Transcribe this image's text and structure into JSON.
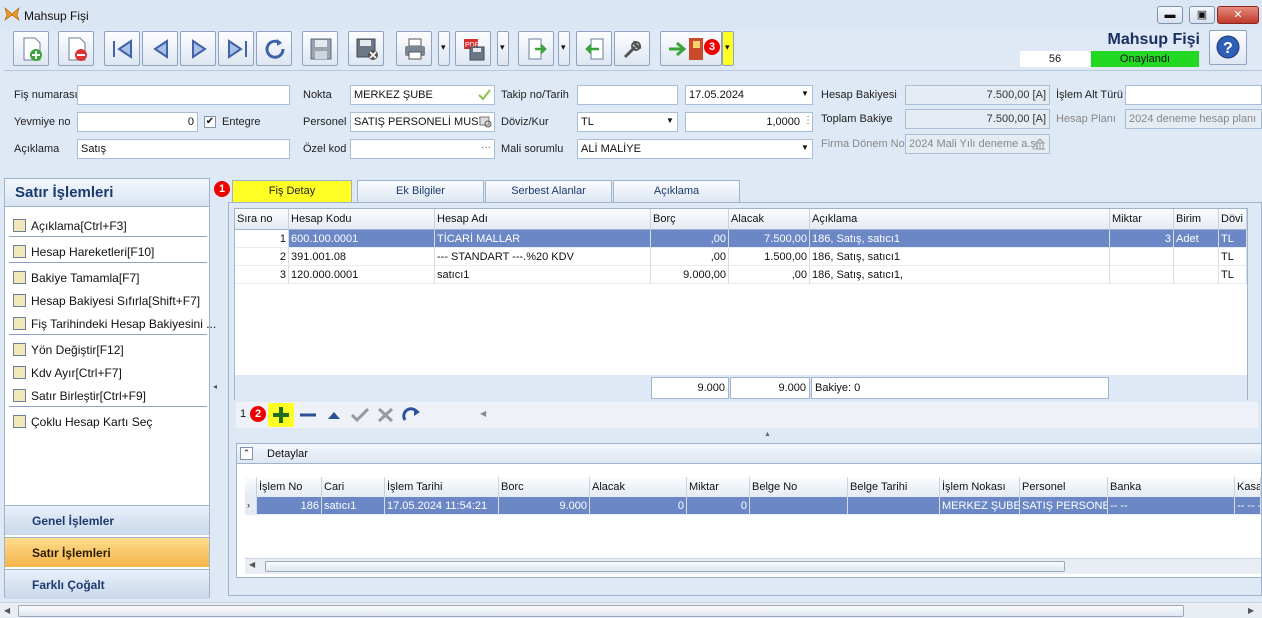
{
  "window": {
    "title": "Mahsup Fişi",
    "minimize": "▬",
    "maximize": "▣",
    "close": "✕"
  },
  "toolbar": {
    "buttons": [
      "new-icon",
      "delete-icon",
      "first-icon",
      "prev-icon",
      "next-icon",
      "last-icon",
      "refresh-icon",
      "save-icon",
      "save-cancel-icon",
      "print-icon",
      "pdf-save-icon",
      "export-icon",
      "import-icon",
      "tools-icon",
      "exit-door-icon"
    ],
    "badge_3": "3"
  },
  "header_right": {
    "title": "Mahsup Fişi",
    "number": "56",
    "status": "Onaylandı",
    "status_color": "#22d822"
  },
  "form": {
    "fis_no_label": "Fiş numarası",
    "fis_no_value": "",
    "yevmiye_label": "Yevmiye no",
    "yevmiye_value": "0",
    "entegre_label": "Entegre",
    "entegre_checked": true,
    "aciklama_label": "Açıklama",
    "aciklama_value": "Satış",
    "nokta_label": "Nokta",
    "nokta_value": "MERKEZ ŞUBE",
    "personel_label": "Personel",
    "personel_value": "SATIŞ PERSONELİ MUST",
    "ozel_kod_label": "Özel kod",
    "ozel_kod_value": "",
    "takip_label": "Takip no/Tarih",
    "takip_value": "",
    "tarih_value": "17.05.2024",
    "doviz_label": "Döviz/Kur",
    "doviz_value": "TL",
    "kur_value": "1,0000",
    "mali_label": "Mali sorumlu",
    "mali_value": "ALİ MALİYE",
    "hesap_bakiyesi_label": "Hesap Bakiyesi",
    "hesap_bakiyesi_value": "7.500,00 [A]",
    "toplam_bakiye_label": "Toplam Bakiye",
    "toplam_bakiye_value": "7.500,00 [A]",
    "firma_donem_label": "Firma Dönem No",
    "firma_donem_value": "2024 Mali Yılı deneme a.ş.",
    "islem_alt_label": "İşlem Alt Türü",
    "islem_alt_value": "",
    "hesap_plani_label": "Hesap Planı",
    "hesap_plani_value": "2024 deneme hesap planı"
  },
  "left_panel": {
    "title": "Satır İşlemleri",
    "items": [
      "Açıklama[Ctrl+F3]",
      "Hesap Hareketleri[F10]",
      "Bakiye Tamamla[F7]",
      "Hesap Bakiyesi Sıfırla[Shift+F7]",
      "Fiş Tarihindeki Hesap Bakiyesini ...",
      "Yön Değiştir[F12]",
      "Kdv Ayır[Ctrl+F7]",
      "Satır Birleştir[Ctrl+F9]",
      "Çoklu Hesap Kartı Seç"
    ],
    "groups": [
      "Genel İşlemler",
      "Satır İşlemleri",
      "Farklı Çoğalt"
    ]
  },
  "tabs": {
    "badge_1": "1",
    "items": [
      "Fiş Detay",
      "Ek Bilgiler",
      "Serbest Alanlar",
      "Açıklama"
    ]
  },
  "grid": {
    "columns": [
      "Sıra no",
      "Hesap Kodu",
      "Hesap Adı",
      "Borç",
      "Alacak",
      "Açıklama",
      "Miktar",
      "Birim",
      "Dövi"
    ],
    "rows": [
      [
        "1",
        "600.100.0001",
        "TİCARİ MALLAR",
        ",00",
        "7.500,00",
        "186, Satış, satıcı1",
        "3",
        "Adet",
        "TL"
      ],
      [
        "2",
        "391.001.08",
        "--- STANDART ---.%20 KDV",
        ",00",
        "1.500,00",
        "186, Satış, satıcı1",
        "",
        "",
        "TL"
      ],
      [
        "3",
        "120.000.0001",
        "satıcı1",
        "9.000,00",
        ",00",
        "186, Satış, satıcı1,",
        "",
        "",
        "TL"
      ]
    ],
    "footer_borc": "9.000",
    "footer_alacak": "9.000",
    "footer_bakiye": "Bakiye: 0"
  },
  "navigator": {
    "counter": "1",
    "badge_2": "2"
  },
  "details": {
    "title": "Detaylar",
    "columns": [
      "İşlem No",
      "Cari",
      "İşlem Tarihi",
      "Borc",
      "Alacak",
      "Miktar",
      "Belge No",
      "Belge Tarihi",
      "İşlem Nokası",
      "Personel",
      "Banka",
      "Kasa"
    ],
    "row": [
      "186",
      "satıcı1",
      "17.05.2024 11:54:21",
      "9.000",
      "0",
      "0",
      "",
      "",
      "MERKEZ ŞUBE",
      "SATIŞ PERSONE",
      "-- --",
      "-- -- --"
    ]
  }
}
